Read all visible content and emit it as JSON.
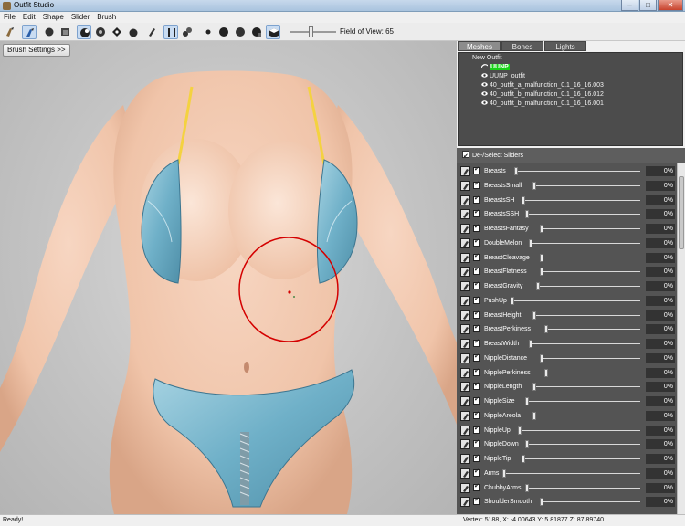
{
  "window": {
    "title": "Outfit Studio",
    "controls": {
      "minimize": "–",
      "maximize": "□",
      "close": "✕"
    }
  },
  "menu": [
    "File",
    "Edit",
    "Shape",
    "Slider",
    "Brush"
  ],
  "toolbar": {
    "fov_label": "Field of View: 65",
    "tools": [
      "brush-select-icon",
      "inflate-brush-icon",
      "deflate-brush-icon",
      "move-brush-icon",
      "smooth-brush-icon",
      "mask-brush-icon",
      "undiff-brush-icon",
      "weight-brush-icon",
      "xmirror-icon",
      "connected-icon",
      "vertex-view-icon",
      "wireframe-icon",
      "lighting-icon",
      "texture-icon",
      "cube-view-icon"
    ]
  },
  "viewport": {
    "brush_settings_button": "Brush Settings >>"
  },
  "panel_tabs": {
    "meshes": "Meshes",
    "bones": "Bones",
    "lights": "Lights"
  },
  "tree": {
    "root": "New Outfit",
    "items": [
      {
        "label": "UUNP",
        "highlighted": true,
        "icon": "skin-icon"
      },
      {
        "label": "UUNP_outfit",
        "highlighted": false,
        "icon": "eye-icon"
      },
      {
        "label": "40_outfit_a_malfunction_0.1_16_16.003",
        "highlighted": false,
        "icon": "eye-icon"
      },
      {
        "label": "40_outfit_b_malfunction_0.1_16_16.012",
        "highlighted": false,
        "icon": "eye-icon"
      },
      {
        "label": "40_outfit_b_malfunction_0.1_16_16.001",
        "highlighted": false,
        "icon": "eye-icon"
      }
    ]
  },
  "sliders": {
    "header": "De-/Select Sliders",
    "items": [
      {
        "name": "Breasts",
        "value": "0%",
        "level": 0
      },
      {
        "name": "BreastsSmall",
        "value": "0%",
        "level": 0
      },
      {
        "name": "BreastsSH",
        "value": "0%",
        "level": 0
      },
      {
        "name": "BreastsSSH",
        "value": "0%",
        "level": 0
      },
      {
        "name": "BreastsFantasy",
        "value": "0%",
        "level": 0
      },
      {
        "name": "DoubleMelon",
        "value": "0%",
        "level": 0
      },
      {
        "name": "BreastCleavage",
        "value": "0%",
        "level": 0
      },
      {
        "name": "BreastFlatness",
        "value": "0%",
        "level": 0
      },
      {
        "name": "BreastGravity",
        "value": "0%",
        "level": 0
      },
      {
        "name": "PushUp",
        "value": "0%",
        "level": 0
      },
      {
        "name": "BreastHeight",
        "value": "0%",
        "level": 0
      },
      {
        "name": "BreastPerkiness",
        "value": "0%",
        "level": 0
      },
      {
        "name": "BreastWidth",
        "value": "0%",
        "level": 0
      },
      {
        "name": "NippleDistance",
        "value": "0%",
        "level": 0
      },
      {
        "name": "NipplePerkiness",
        "value": "0%",
        "level": 0
      },
      {
        "name": "NippleLength",
        "value": "0%",
        "level": 0
      },
      {
        "name": "NippleSize",
        "value": "0%",
        "level": 0
      },
      {
        "name": "NippleAreola",
        "value": "0%",
        "level": 0
      },
      {
        "name": "NippleUp",
        "value": "0%",
        "level": 0
      },
      {
        "name": "NippleDown",
        "value": "0%",
        "level": 0
      },
      {
        "name": "NippleTip",
        "value": "0%",
        "level": 0
      },
      {
        "name": "Arms",
        "value": "0%",
        "level": 0
      },
      {
        "name": "ChubbyArms",
        "value": "0%",
        "level": 0
      },
      {
        "name": "ShoulderSmooth",
        "value": "0%",
        "level": 0
      }
    ]
  },
  "status": {
    "left": "Ready!",
    "right": "Vertex: 5188, X: -4.00643 Y: 5.81877 Z: 87.89740"
  },
  "colors": {
    "highlight": "#17d217",
    "brush_circle": "#d40000",
    "denim": "#6fb0c8",
    "skin": "#f1c9b1"
  }
}
